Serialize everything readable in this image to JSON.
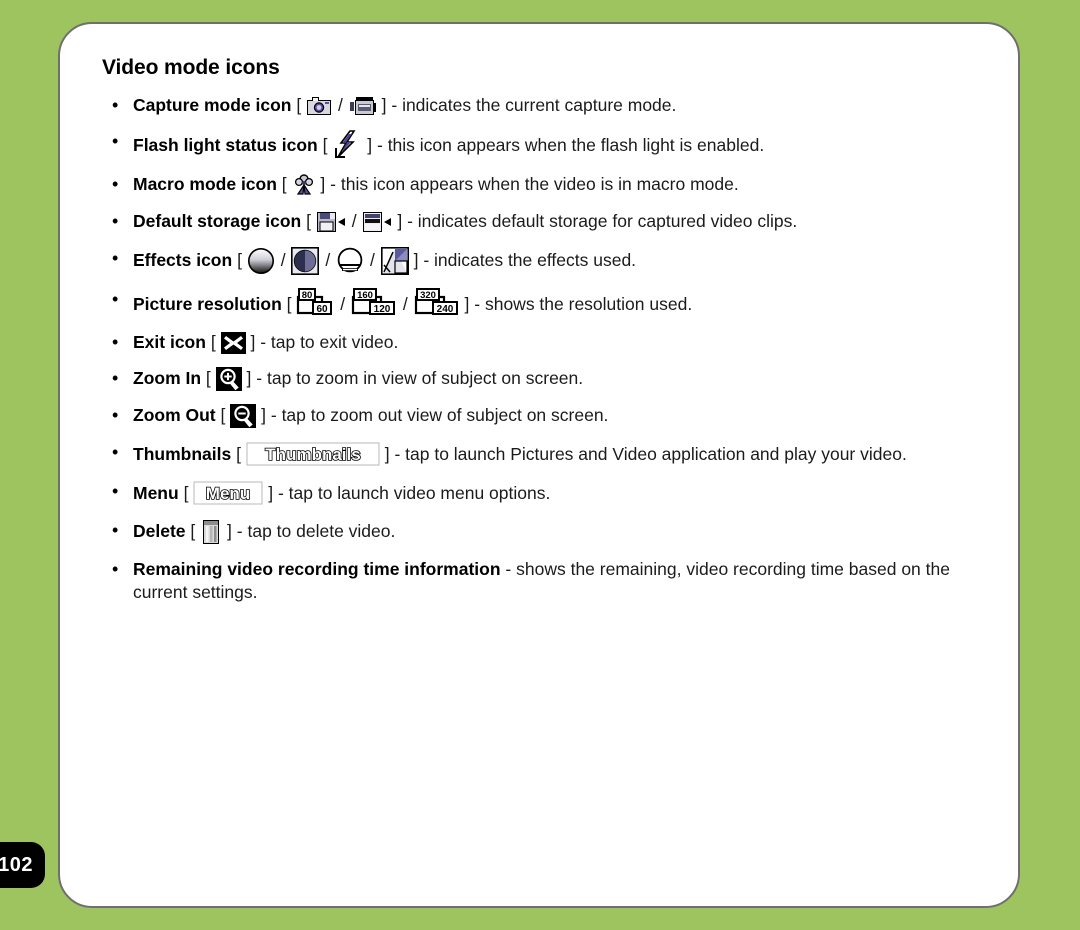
{
  "page": {
    "number": "102",
    "background_color": "#9ec45f",
    "panel_color": "#ffffff",
    "panel_border_color": "#6f6f6f",
    "page_tab_color": "#000000"
  },
  "section": {
    "title": "Video mode icons"
  },
  "bullets": [
    {
      "label": "Capture mode icon",
      "icons": [
        "camera-icon",
        "video-camera-icon"
      ],
      "icon_separator": "/",
      "open_bracket": "[",
      "close_bracket": "]",
      "description": "- indicates the current capture mode."
    },
    {
      "label": "Flash light status icon",
      "icons": [
        "flash-lightning-icon"
      ],
      "icon_separator": "",
      "open_bracket": "[",
      "close_bracket": "]",
      "description": "- this icon appears when the flash light is enabled."
    },
    {
      "label": "Macro mode icon",
      "icons": [
        "macro-flower-icon"
      ],
      "icon_separator": "",
      "open_bracket": "[",
      "close_bracket": "]",
      "description": "- this icon appears when the video is in macro mode."
    },
    {
      "label": "Default storage icon",
      "icons": [
        "memory-card-storage-icon",
        "internal-storage-icon"
      ],
      "icon_separator": "/",
      "open_bracket": "[",
      "close_bracket": "]",
      "description": "- indicates default storage for captured video clips."
    },
    {
      "label": "Effects icon",
      "icons": [
        "effect-normal-icon",
        "effect-grayscale-icon",
        "effect-sepia-icon",
        "effect-negative-icon"
      ],
      "icon_separator": "/",
      "open_bracket": "[",
      "close_bracket": "]",
      "description": "- indicates the effects used."
    },
    {
      "label": "Picture resolution",
      "icons": [
        "resolution-80x60-icon",
        "resolution-160x120-icon",
        "resolution-320x240-icon"
      ],
      "icon_separator": "/",
      "open_bracket": "[",
      "close_bracket": "]",
      "description": "- shows the resolution used."
    },
    {
      "label": "Exit icon",
      "icons": [
        "exit-x-icon"
      ],
      "icon_separator": "",
      "open_bracket": "[",
      "close_bracket": "]",
      "description": "- tap to exit video."
    },
    {
      "label": "Zoom In",
      "icons": [
        "zoom-in-icon"
      ],
      "icon_separator": "",
      "open_bracket": "[",
      "close_bracket": "]",
      "description": "- tap to zoom in view of subject on screen."
    },
    {
      "label": "Zoom Out",
      "icons": [
        "zoom-out-icon"
      ],
      "icon_separator": "",
      "open_bracket": "[",
      "close_bracket": "]",
      "description": "- tap to zoom out view of subject on screen."
    },
    {
      "label": "Thumbnails",
      "icons": [
        "thumbnails-button-icon"
      ],
      "icon_separator": "",
      "open_bracket": "[",
      "close_bracket": "]",
      "description": "- tap to launch Pictures and Video application and play your video."
    },
    {
      "label": "Menu",
      "icons": [
        "menu-button-icon"
      ],
      "icon_separator": "",
      "open_bracket": "[",
      "close_bracket": "]",
      "description": "- tap to launch video menu options."
    },
    {
      "label": "Delete",
      "icons": [
        "delete-trash-icon"
      ],
      "icon_separator": "",
      "open_bracket": "[",
      "close_bracket": "]",
      "description": "- tap to delete video."
    },
    {
      "label": "Remaining video recording time information",
      "icons": [],
      "icon_separator": "",
      "open_bracket": "",
      "close_bracket": "",
      "description": "- shows the remaining, video recording time based on the current settings."
    }
  ],
  "icon_labels": {
    "thumbnails_button_text": "Thumbnails",
    "menu_button_text": "Menu",
    "resolution_80": "80",
    "resolution_60": "60",
    "resolution_160": "160",
    "resolution_120": "120",
    "resolution_320": "320",
    "resolution_240": "240"
  }
}
